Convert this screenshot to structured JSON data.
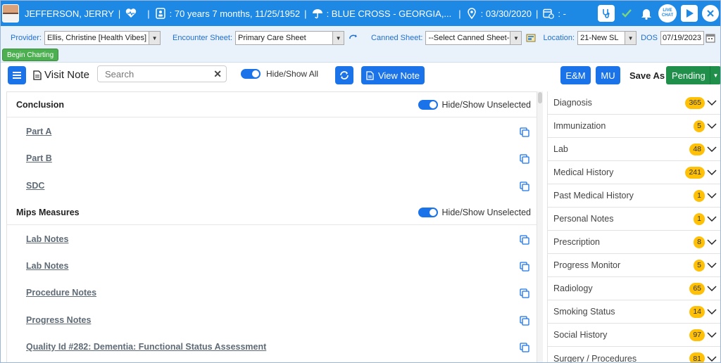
{
  "patient_bar": {
    "patient_name": "JEFFERSON, JERRY",
    "separator": "|",
    "age_dob": ": 70 years 7 months, 11/25/1952",
    "insurance": ": BLUE CROSS - GEORGIA,...",
    "appointment_date": ": 03/30/2020",
    "extra": ": -",
    "live_chat": "LIVE CHAT"
  },
  "filters": {
    "provider_label": "Provider:",
    "provider_value": "Ellis, Christine [Health Vibes]",
    "encounter_label": "Encounter Sheet:",
    "encounter_value": "Primary Care Sheet",
    "canned_label": "Canned Sheet:",
    "canned_value": "--Select Canned Sheet--",
    "location_label": "Location:",
    "location_value": "21-New SL",
    "dos_label": "DOS",
    "dos_value": "07/19/2023",
    "begin_charting": "Begin Charting"
  },
  "toolbar": {
    "title": "Visit Note",
    "search_placeholder": "Search",
    "hide_show_all": "Hide/Show All",
    "view_note": "View Note",
    "em": "E&M",
    "mu": "MU",
    "save_as": "Save As",
    "status": "Pending"
  },
  "sections": [
    {
      "title": "Conclusion",
      "toggle_label": "Hide/Show Unselected",
      "items": [
        "Part A",
        "Part B",
        "SDC"
      ]
    },
    {
      "title": "Mips Measures",
      "toggle_label": "Hide/Show Unselected",
      "items": [
        "Lab Notes",
        "Lab Notes",
        "Procedure Notes",
        "Progress Notes",
        "Quality Id #282: Dementia: Functional Status Assessment"
      ]
    }
  ],
  "categories": [
    {
      "name": "Diagnosis",
      "count": "365"
    },
    {
      "name": "Immunization",
      "count": "5"
    },
    {
      "name": "Lab",
      "count": "48"
    },
    {
      "name": "Medical History",
      "count": "241"
    },
    {
      "name": "Past Medical History",
      "count": "1"
    },
    {
      "name": "Personal Notes",
      "count": "1"
    },
    {
      "name": "Prescription",
      "count": "8"
    },
    {
      "name": "Progress Monitor",
      "count": "5"
    },
    {
      "name": "Radiology",
      "count": "65"
    },
    {
      "name": "Smoking Status",
      "count": "14"
    },
    {
      "name": "Social History",
      "count": "97"
    },
    {
      "name": "Surgery / Procedures",
      "count": "81"
    }
  ],
  "colors": {
    "primary_blue": "#1e88e5",
    "button_blue": "#1a73e8",
    "badge_yellow": "#ffc107",
    "pending_green": "#1f8f4a",
    "begin_green": "#4caf50"
  }
}
